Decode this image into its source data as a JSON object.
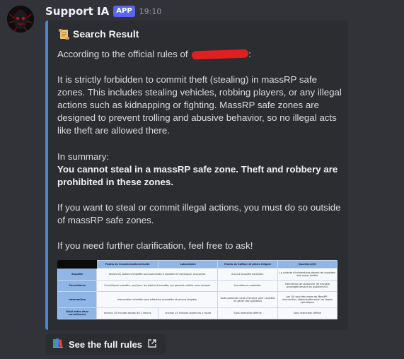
{
  "message": {
    "author": "Support IA",
    "badge": "APP",
    "time": "19:10"
  },
  "embed": {
    "title_icon": "scroll-icon",
    "title": "Search Result",
    "intro": "According to the official rules of",
    "intro_suffix": ":",
    "paragraph1": "It is strictly forbidden to commit theft (stealing) in massRP safe zones. This includes stealing vehicles, robbing players, or any illegal actions such as kidnapping or fighting. MassRP safe zones are designed to prevent trolling and abusive behavior, so no illegal acts like theft are allowed there.",
    "summary_label": "In summary:",
    "summary_bold": "You cannot steal in a massRP safe zone. Theft and robbery are prohibited in these zones.",
    "paragraph3": "If you want to steal or commit illegal actions, you must do so outside of massRP safe zones.",
    "paragraph4": "If you need further clarification, feel free to ask!",
    "accent_color": "#3f8ae0",
    "table": {
      "headers": [
        "",
        "Points de transformation/récolte",
        "Laboratoire",
        "Points de Saffuer et pêche illégale",
        "Quartiers/QG"
      ],
      "rows": [
        [
          "Enquête",
          "Seules les saisies d'enquête sont autorisées à localiser et investiguer ces points.",
          "",
          "Aucune enquête autorisée.",
          "La collecte d'informations devant les quartiers doit rester limitée"
        ],
        [
          "Surveillance",
          "Surveillance interdite, seuf pour les saisies d'enquête, qui peuvent vérifier sous cavaper",
          "",
          "Surveillance autorisée.",
          "Interdiction de stationner de manière prolongée devant les quartiers/QG"
        ],
        [
          "Intervention",
          "Intervention interdite sans infraction constatée et preuve tangible.",
          "",
          "Toute patrouille peut intervenir pour contrôler en geuer des questions",
          "Les QG sont des zones de MassRP : intervention réglementée selon les règles spécifiques"
        ],
        [
          "Délai entre deux surveillances",
          "environ 15 minutes toutes les 2 heures",
          "environ 15 minutes toutes les 1 heure",
          "Sans restriction définie",
          "Sans restriction définie"
        ]
      ]
    }
  },
  "button": {
    "icon": "books-icon",
    "label": "See the full rules",
    "trailing_icon": "external-link-icon"
  }
}
